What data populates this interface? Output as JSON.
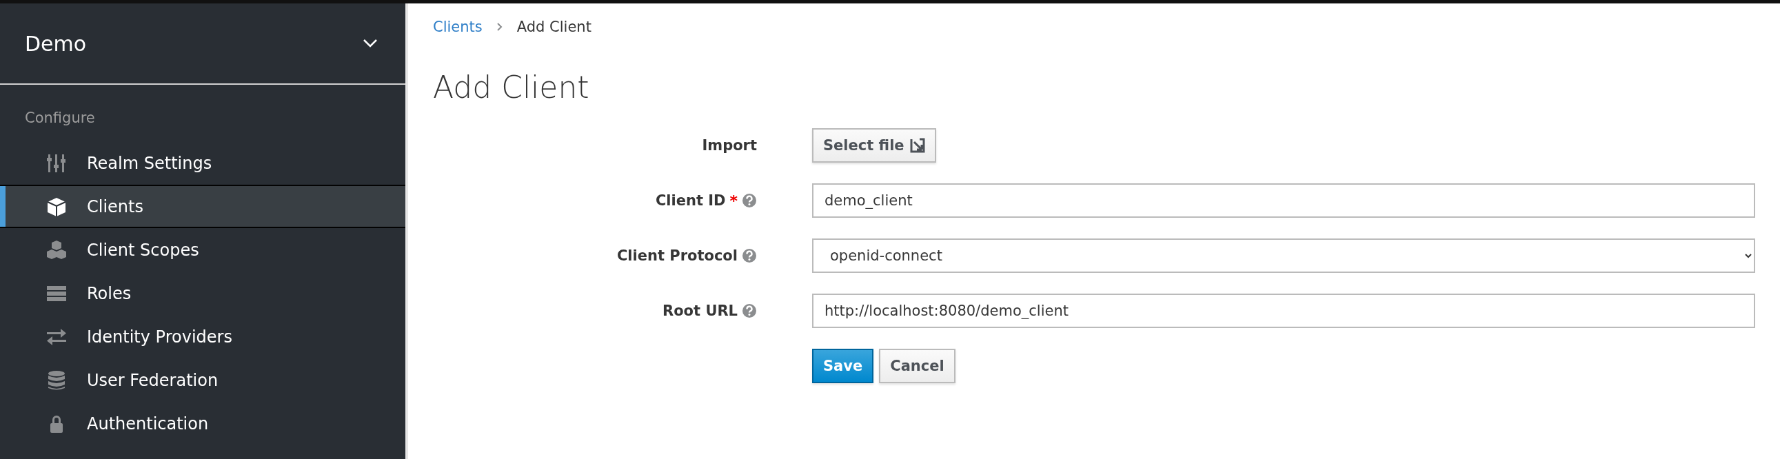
{
  "sidebar": {
    "realm": "Demo",
    "section": "Configure",
    "items": [
      {
        "label": "Realm Settings",
        "kind": "sliders",
        "selected": false
      },
      {
        "label": "Clients",
        "kind": "cube",
        "selected": true
      },
      {
        "label": "Client Scopes",
        "kind": "cubes",
        "selected": false
      },
      {
        "label": "Roles",
        "kind": "list",
        "selected": false
      },
      {
        "label": "Identity Providers",
        "kind": "exchange",
        "selected": false
      },
      {
        "label": "User Federation",
        "kind": "database",
        "selected": false
      },
      {
        "label": "Authentication",
        "kind": "lock",
        "selected": false
      }
    ]
  },
  "breadcrumb": [
    {
      "label": "Clients",
      "kind": "link"
    },
    {
      "label": "Add Client",
      "kind": "current"
    }
  ],
  "title": "Add Client",
  "form": {
    "fields": [
      {
        "kind": "file",
        "label": "Import",
        "button": "Select file",
        "required": false,
        "help": false
      },
      {
        "kind": "text",
        "label": "Client ID",
        "value": "demo_client",
        "required": true,
        "required_mark": "*",
        "help": true
      },
      {
        "kind": "select",
        "label": "Client Protocol",
        "value": "openid-connect",
        "required": false,
        "help": true
      },
      {
        "kind": "text",
        "label": "Root URL",
        "value": "http://localhost:8080/demo_client",
        "required": false,
        "help": true
      }
    ],
    "actions": [
      {
        "label": "Save",
        "kind": "primary"
      },
      {
        "label": "Cancel",
        "kind": "default"
      }
    ]
  }
}
